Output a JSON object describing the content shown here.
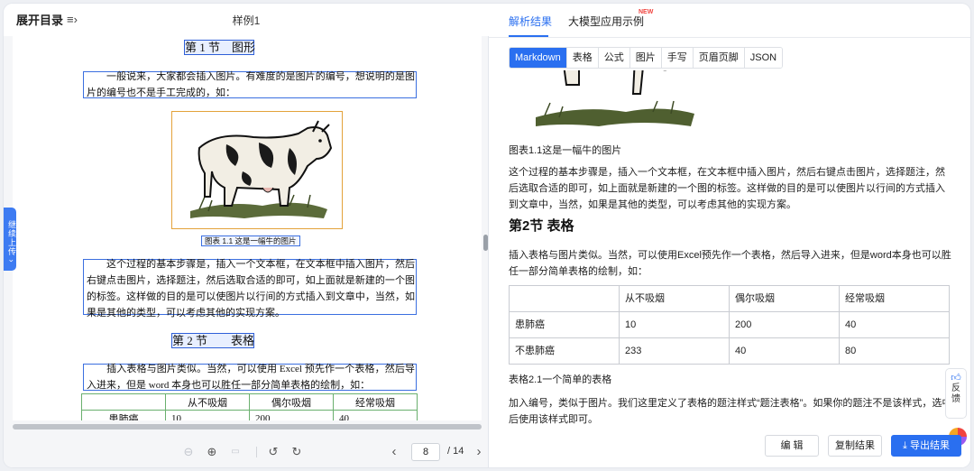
{
  "left": {
    "toc_label": "展开目录",
    "toc_icon": "list-indent-icon",
    "doc_title": "样例1",
    "side_tab": "继续上传",
    "page": {
      "section1_title": "第 1 节　图形",
      "para1": "一般说来，大家都会插入图片。有难度的是图片的编号，想说明的是图片的编号也不是手工完成的，如：",
      "caption1": "图表 1.1 这是一幅牛的图片",
      "para2": "这个过程的基本步骤是，插入一个文本框，在文本框中插入图片，然后右键点击图片，选择题注，然后选取合适的即可，如上面就是新建的一个图的标签。这样做的目的是可以使图片以行间的方式插入到文章中，当然，如果是其他的类型，可以考虑其他的实现方案。",
      "section2_title": "第 2 节　　表格",
      "para3": "插入表格与图片类似。当然，可以使用 Excel 预先作一个表格，然后导入进来，但是 word 本身也可以胜任一部分简单表格的绘制，如：",
      "table": {
        "header": [
          "",
          "从不吸烟",
          "偶尔吸烟",
          "经常吸烟"
        ],
        "rows": [
          [
            "患肺癌",
            "10",
            "200",
            "40"
          ]
        ]
      }
    },
    "toolbar": {
      "current_page": "8",
      "total": "/ 14"
    }
  },
  "right": {
    "tabs": [
      "解析结果",
      "大模型应用示例"
    ],
    "new_badge": "NEW",
    "formats": [
      "Markdown",
      "表格",
      "公式",
      "图片",
      "手写",
      "页眉页脚",
      "JSON"
    ],
    "content": {
      "caption1": "图表1.1这是一幅牛的图片",
      "para1": "这个过程的基本步骤是，插入一个文本框，在文本框中插入图片，然后右键点击图片，选择题注，然后选取合适的即可，如上面就是新建的一个图的标签。这样做的目的是可以使图片以行间的方式插入到文章中，当然，如果是其他的类型，可以考虑其他的实现方案。",
      "heading": "第2节 表格",
      "para2": "插入表格与图片类似。当然，可以使用Excel预先作一个表格，然后导入进来，但是word本身也可以胜任一部分简单表格的绘制，如：",
      "table": {
        "header": [
          "",
          "从不吸烟",
          "偶尔吸烟",
          "经常吸烟"
        ],
        "rows": [
          [
            "患肺癌",
            "10",
            "200",
            "40"
          ],
          [
            "不患肺癌",
            "233",
            "40",
            "80"
          ]
        ]
      },
      "caption2": "表格2.1一个简单的表格",
      "para3": "加入编号，类似于图片。我们这里定义了表格的题注样式“题注表格”。如果你的题注不是该样式，选中后使用该样式即可。"
    },
    "feedback": "反馈",
    "buttons": {
      "edit": "编 辑",
      "copy": "复制结果",
      "export": "导出结果"
    }
  },
  "colors": {
    "accent": "#2a6ff0",
    "badge": "#f0443f",
    "table_green": "#6ab06e"
  }
}
